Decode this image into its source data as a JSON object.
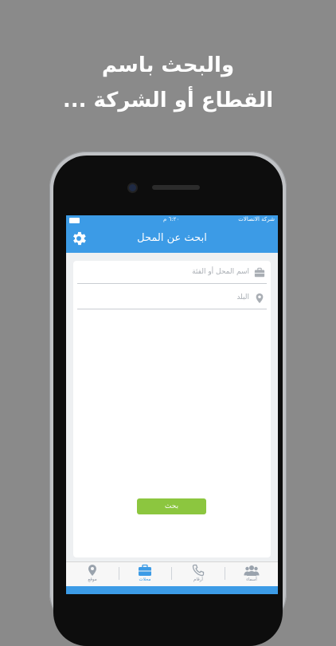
{
  "promo": {
    "line1": "والبحث باسم",
    "line2": "القطاع أو الشركة ..."
  },
  "status_bar": {
    "carrier": "شركة الاتصالات",
    "time": "٦:٢٠ م"
  },
  "header": {
    "title": "ابحث عن المحل",
    "settings_icon": "gear-icon"
  },
  "search_form": {
    "name_field": {
      "placeholder": "اسم المحل أو الفئة",
      "icon": "briefcase-icon"
    },
    "city_field": {
      "placeholder": "البلد",
      "icon": "location-pin-icon"
    },
    "search_button": "بحث"
  },
  "tabs": [
    {
      "label": "موقع",
      "icon": "location-pin-icon"
    },
    {
      "label": "محلات",
      "icon": "briefcase-icon",
      "active": true
    },
    {
      "label": "أرقام",
      "icon": "phone-icon"
    },
    {
      "label": "أسماء",
      "icon": "people-icon"
    }
  ],
  "colors": {
    "accent": "#3c9be6",
    "button": "#8cc63f",
    "background": "#8a8a8a"
  }
}
